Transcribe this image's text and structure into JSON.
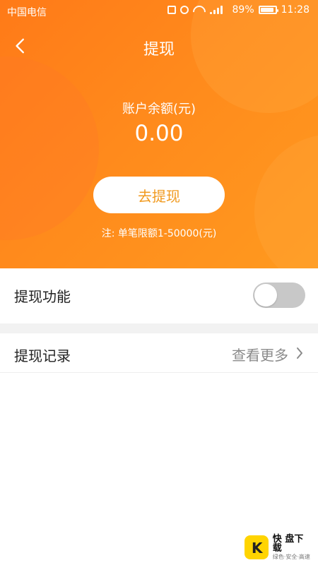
{
  "status_bar": {
    "carrier": "中国电信",
    "battery": "89%",
    "time": "11:28"
  },
  "header": {
    "title": "提现"
  },
  "balance": {
    "label": "账户余额(元)",
    "value": "0.00"
  },
  "actions": {
    "withdraw_button": "去提现"
  },
  "notes": {
    "limit": "注: 单笔限额1-50000(元)"
  },
  "rows": {
    "withdraw_feature": {
      "label": "提现功能",
      "toggle_on": false
    },
    "withdraw_records": {
      "label": "提现记录",
      "more": "查看更多"
    }
  },
  "watermark": {
    "logo_letter": "K",
    "title": "快 盘下载",
    "subtitle": "绿色·安全·高速"
  },
  "colors": {
    "primary_orange": "#ff8a1c",
    "button_text": "#f19a1f",
    "toggle_off": "#c8c8c8"
  }
}
